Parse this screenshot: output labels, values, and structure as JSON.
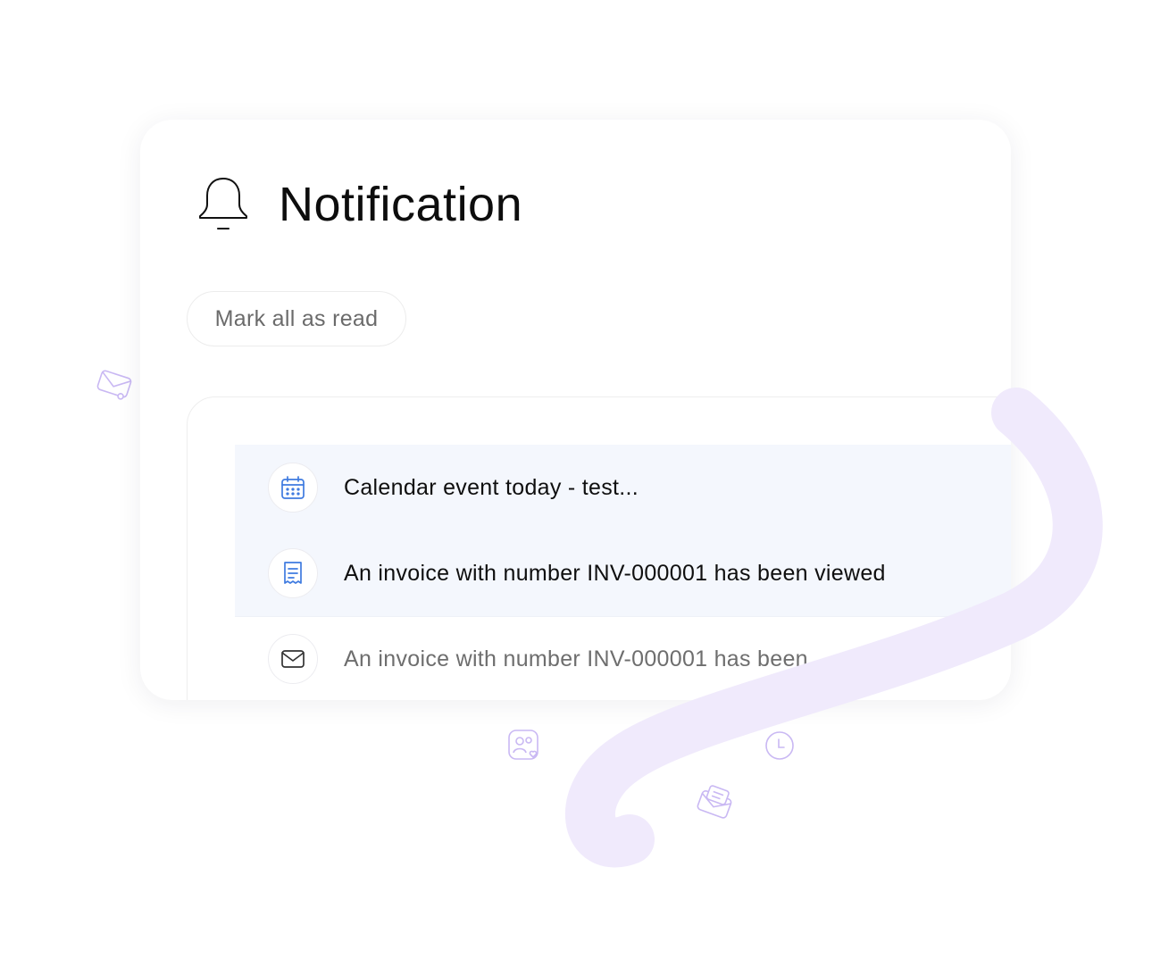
{
  "colors": {
    "accent_blue": "#3f7be0",
    "decor_purple": "#c9b8f3",
    "swoosh_purple": "#f0eafc",
    "unread_background": "#f4f7fd"
  },
  "header": {
    "icon": "bell-icon",
    "title": "Notification"
  },
  "actions": {
    "mark_all_read_label": "Mark all as read"
  },
  "notifications": [
    {
      "icon": "calendar-icon",
      "text": "Calendar event today - test...",
      "unread": true
    },
    {
      "icon": "document-icon",
      "text": "An invoice with number INV-000001 has been viewed",
      "unread": true
    },
    {
      "icon": "envelope-icon",
      "text": "An invoice with number INV-000001 has been",
      "unread": false
    }
  ],
  "decorations": [
    "sliders-icon",
    "envelope-icon",
    "briefcase-icon",
    "contacts-icon",
    "clock-icon",
    "mailbox-icon"
  ]
}
